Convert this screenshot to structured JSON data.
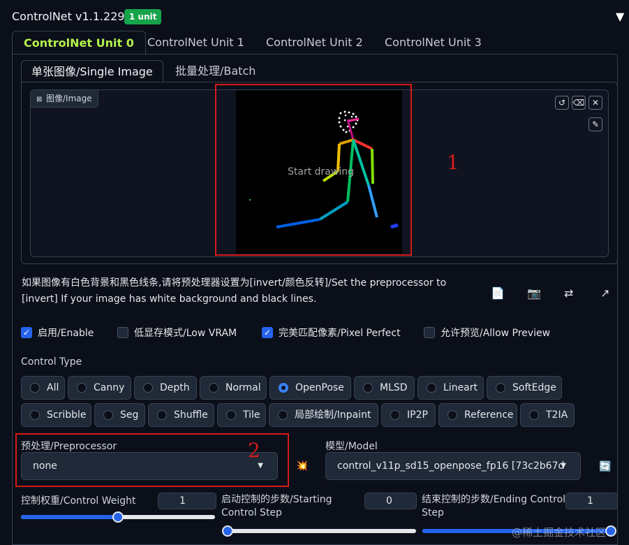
{
  "header": {
    "title": "ControlNet v1.1.229",
    "badge": "1 unit",
    "collapse_icon": "▼"
  },
  "unit_tabs": [
    "ControlNet Unit 0",
    "ControlNet Unit 1",
    "ControlNet Unit 2",
    "ControlNet Unit 3"
  ],
  "mode_tabs": [
    "单张图像/Single Image",
    "批量处理/Batch"
  ],
  "image_panel": {
    "label": "图像/Image",
    "label_icon": "image-icon",
    "canvas_text": "Start drawing",
    "buttons": [
      "undo-icon",
      "eraser-icon",
      "close-icon",
      "brush-icon"
    ]
  },
  "annotations": {
    "one": "1",
    "two": "2"
  },
  "hint": "如果图像有白色背景和黑色线条,请将预处理器设置为[invert/颜色反转]/Set the preprocessor to [invert] If your image has white background and black lines.",
  "tool_icons": [
    "📄",
    "📷",
    "⇄",
    "↗"
  ],
  "checkboxes": [
    {
      "label": "启用/Enable",
      "checked": true
    },
    {
      "label": "低显存模式/Low VRAM",
      "checked": false
    },
    {
      "label": "完美匹配像素/Pixel Perfect",
      "checked": true
    },
    {
      "label": "允许预览/Allow Preview",
      "checked": false
    }
  ],
  "control_type": {
    "label": "Control Type",
    "options": [
      "All",
      "Canny",
      "Depth",
      "Normal",
      "OpenPose",
      "MLSD",
      "Lineart",
      "SoftEdge",
      "Scribble",
      "Seg",
      "Shuffle",
      "Tile",
      "局部绘制/Inpaint",
      "IP2P",
      "Reference",
      "T2IA"
    ],
    "selected": "OpenPose"
  },
  "preprocessor": {
    "label": "预处理/Preprocessor",
    "value": "none"
  },
  "model": {
    "label": "模型/Model",
    "value": "control_v11p_sd15_openpose_fp16 [73c2b67d",
    "run_icon": "💥",
    "refresh_icon": "🔄"
  },
  "sliders": {
    "weight": {
      "label": "控制权重/Control Weight",
      "value": "1",
      "fraction": 0.5
    },
    "start": {
      "label": "启动控制的步数/Starting Control Step",
      "value": "0",
      "fraction": 0.0
    },
    "end": {
      "label": "结束控制的步数/Ending Control Step",
      "value": "1",
      "fraction": 1.0
    }
  },
  "watermark": "@稀土掘金技术社区"
}
